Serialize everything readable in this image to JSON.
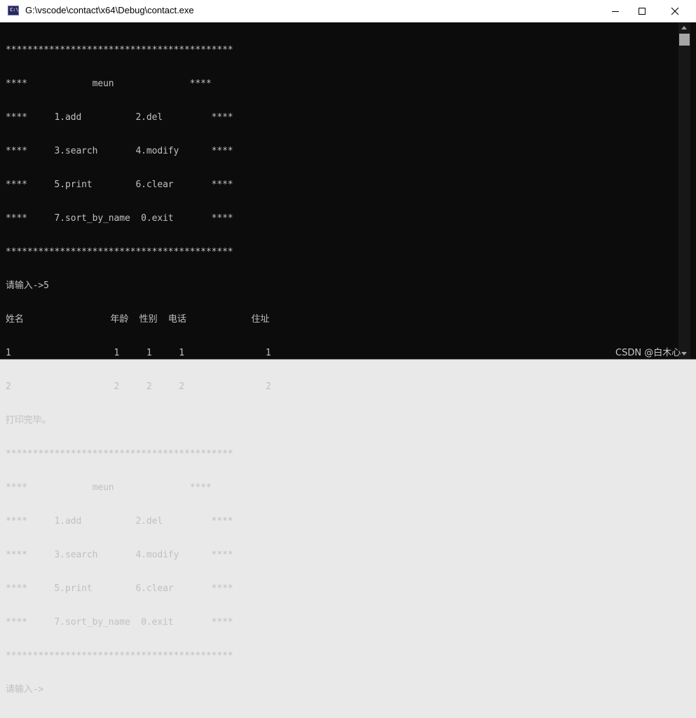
{
  "window": {
    "title": "G:\\vscode\\contact\\x64\\Debug\\contact.exe",
    "icon": "console-app-icon",
    "icon_text": "C:\\"
  },
  "console": {
    "lines": [
      "******************************************",
      "****            meun              ****",
      "****     1.add          2.del         ****",
      "****     3.search       4.modify      ****",
      "****     5.print        6.clear       ****",
      "****     7.sort_by_name  0.exit       ****",
      "******************************************",
      "请输入->5",
      "姓名                年龄  性别  电话            住址",
      "1                   1     1     1               1",
      "2                   2     2     2               2",
      "打印完毕。",
      "******************************************",
      "****            meun              ****",
      "****     1.add          2.del         ****",
      "****     3.search       4.modify      ****",
      "****     5.print        6.clear       ****",
      "****     7.sort_by_name  0.exit       ****",
      "******************************************",
      "请输入->"
    ]
  },
  "watermark": "CSDN @白木心",
  "backdrop": {
    "glyph_a": "o",
    "glyph_b": "i",
    "glyph_c": "‡"
  },
  "colors": {
    "console_bg": "#0c0c0c",
    "console_text": "#c0c0c0",
    "titlebar_bg": "#ffffff"
  }
}
